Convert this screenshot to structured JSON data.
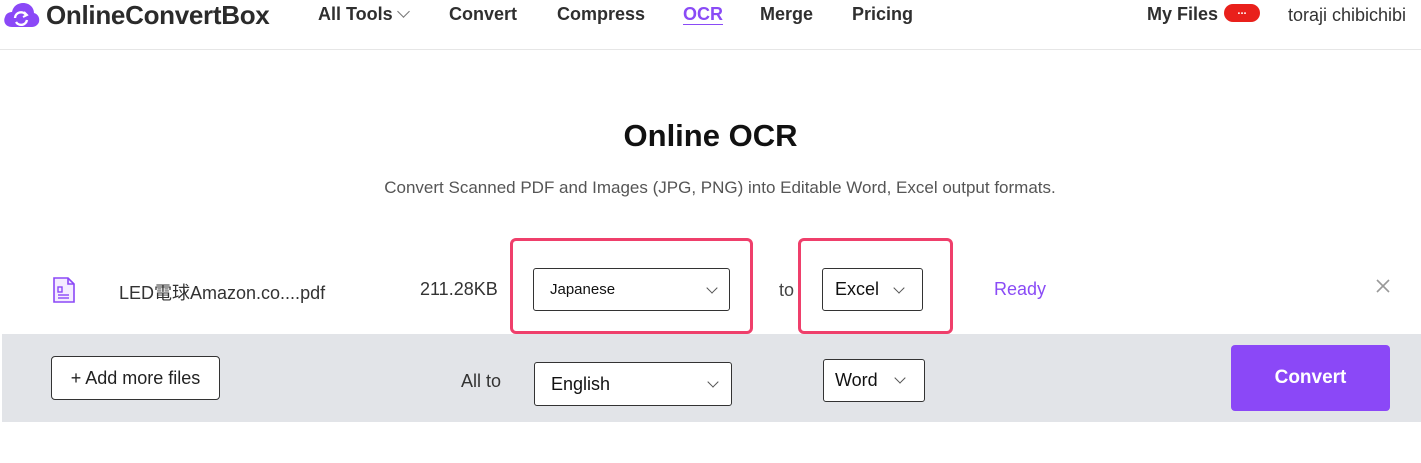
{
  "header": {
    "logo_text": "OnlineConvertBox",
    "nav": [
      {
        "label": "All Tools"
      },
      {
        "label": "Convert"
      },
      {
        "label": "Compress"
      },
      {
        "label": "OCR"
      },
      {
        "label": "Merge"
      },
      {
        "label": "Pricing"
      }
    ],
    "my_files_label": "My Files",
    "my_files_badge": "...",
    "username": "toraji chibichibi"
  },
  "main": {
    "title": "Online OCR",
    "subtitle": "Convert Scanned PDF and Images (JPG, PNG) into Editable Word, Excel output formats."
  },
  "file": {
    "name": "LED電球Amazon.co....pdf",
    "size": "211.28KB",
    "language": "Japanese",
    "to_label": "to",
    "format": "Excel",
    "status": "Ready"
  },
  "bottom_bar": {
    "add_more_label": "+ Add more files",
    "all_to_label": "All to",
    "all_language": "English",
    "all_format": "Word",
    "convert_label": "Convert"
  },
  "colors": {
    "accent": "#8b48f7",
    "highlight": "#ef3f6b",
    "badge": "#e9201b"
  }
}
